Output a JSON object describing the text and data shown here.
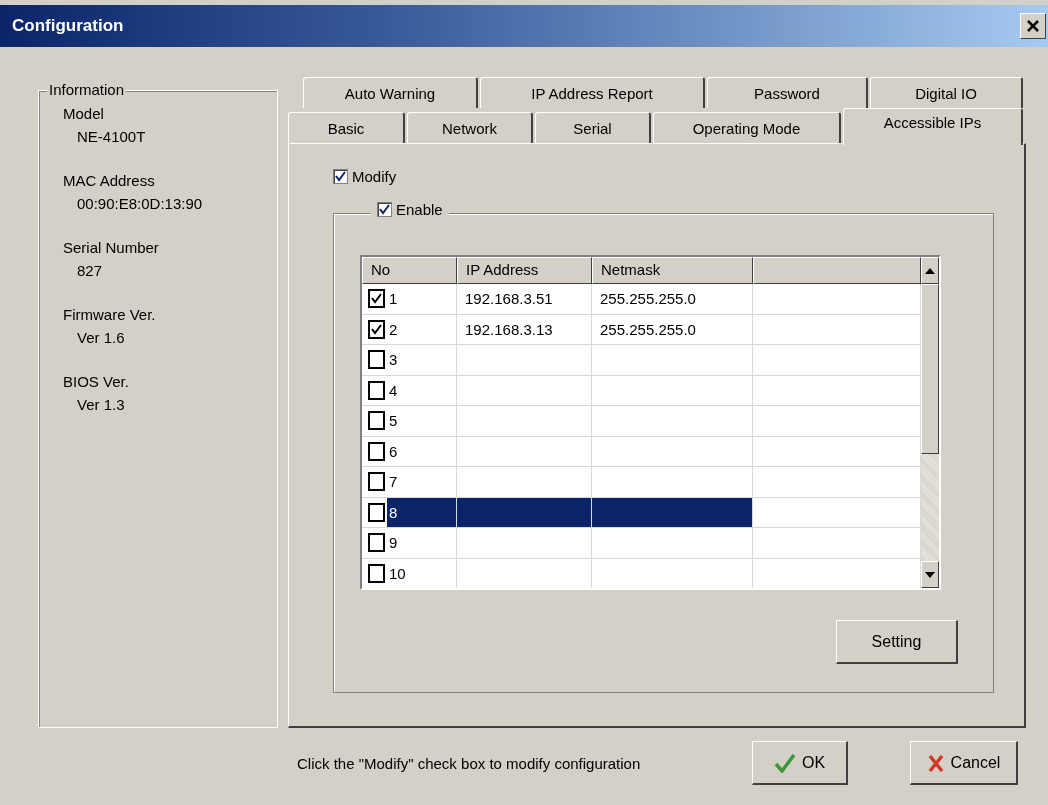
{
  "window": {
    "title": "Configuration"
  },
  "information": {
    "title": "Information",
    "fields": [
      {
        "label": "Model",
        "value": "NE-4100T"
      },
      {
        "label": "MAC Address",
        "value": "00:90:E8:0D:13:90"
      },
      {
        "label": "Serial Number",
        "value": "827"
      },
      {
        "label": "Firmware Ver.",
        "value": "Ver 1.6"
      },
      {
        "label": "BIOS Ver.",
        "value": "Ver 1.3"
      }
    ]
  },
  "tab_rows": [
    [
      {
        "label": "Auto Warning",
        "selected": false
      },
      {
        "label": "IP Address Report",
        "selected": false
      },
      {
        "label": "Password",
        "selected": false
      },
      {
        "label": "Digital IO",
        "selected": false
      }
    ],
    [
      {
        "label": "Basic",
        "selected": false
      },
      {
        "label": "Network",
        "selected": false
      },
      {
        "label": "Serial",
        "selected": false
      },
      {
        "label": "Operating Mode",
        "selected": false
      },
      {
        "label": "Accessible IPs",
        "selected": true
      }
    ]
  ],
  "modify": {
    "label": "Modify",
    "checked": true
  },
  "enable": {
    "label": "Enable",
    "checked": true
  },
  "table": {
    "columns": [
      "No",
      "IP Address",
      "Netmask"
    ],
    "rows": [
      {
        "no": "1",
        "checked": true,
        "ip": "192.168.3.51",
        "netmask": "255.255.255.0",
        "selected": false
      },
      {
        "no": "2",
        "checked": true,
        "ip": "192.168.3.13",
        "netmask": "255.255.255.0",
        "selected": false
      },
      {
        "no": "3",
        "checked": false,
        "selected": false
      },
      {
        "no": "4",
        "checked": false,
        "selected": false
      },
      {
        "no": "5",
        "checked": false,
        "selected": false
      },
      {
        "no": "6",
        "checked": false,
        "selected": false
      },
      {
        "no": "7",
        "checked": false,
        "selected": false
      },
      {
        "no": "8",
        "checked": false,
        "selected": true
      },
      {
        "no": "9",
        "checked": false,
        "selected": false
      },
      {
        "no": "10",
        "checked": false,
        "selected": false
      }
    ]
  },
  "setting_button": "Setting",
  "hint": "Click the \"Modify\" check box to modify configuration",
  "ok_button": "OK",
  "cancel_button": "Cancel"
}
